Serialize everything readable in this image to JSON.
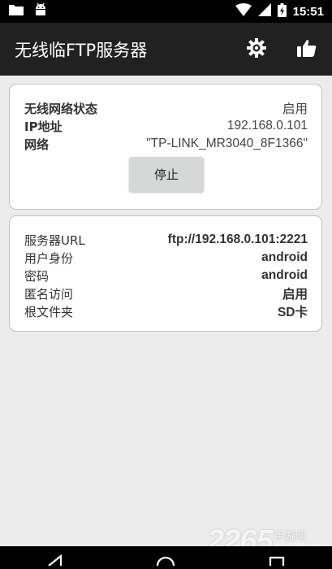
{
  "status_bar": {
    "time": "15:51"
  },
  "app_bar": {
    "title": "无线临FTP服务器"
  },
  "network_card": {
    "rows": [
      {
        "label": "无线网络状态",
        "value": "启用"
      },
      {
        "label": "IP地址",
        "value": "192.168.0.101"
      },
      {
        "label": "网络",
        "value": "\"TP-LINK_MR3040_8F1366\""
      }
    ],
    "stop_label": "停止"
  },
  "server_card": {
    "rows": [
      {
        "label": "服务器URL",
        "value": "ftp://192.168.0.101:2221"
      },
      {
        "label": "用户身份",
        "value": "android"
      },
      {
        "label": "密码",
        "value": "android"
      },
      {
        "label": "匿名访问",
        "value": "启用"
      },
      {
        "label": "根文件夹",
        "value": "SD卡"
      }
    ]
  },
  "watermark": {
    "number": "2265",
    "text": "手游网",
    "url": "2265.com"
  },
  "colors": {
    "app_bar": "#212121",
    "background": "#ececec",
    "card_border": "#b9c3cc",
    "button": "#d6d7d7"
  }
}
